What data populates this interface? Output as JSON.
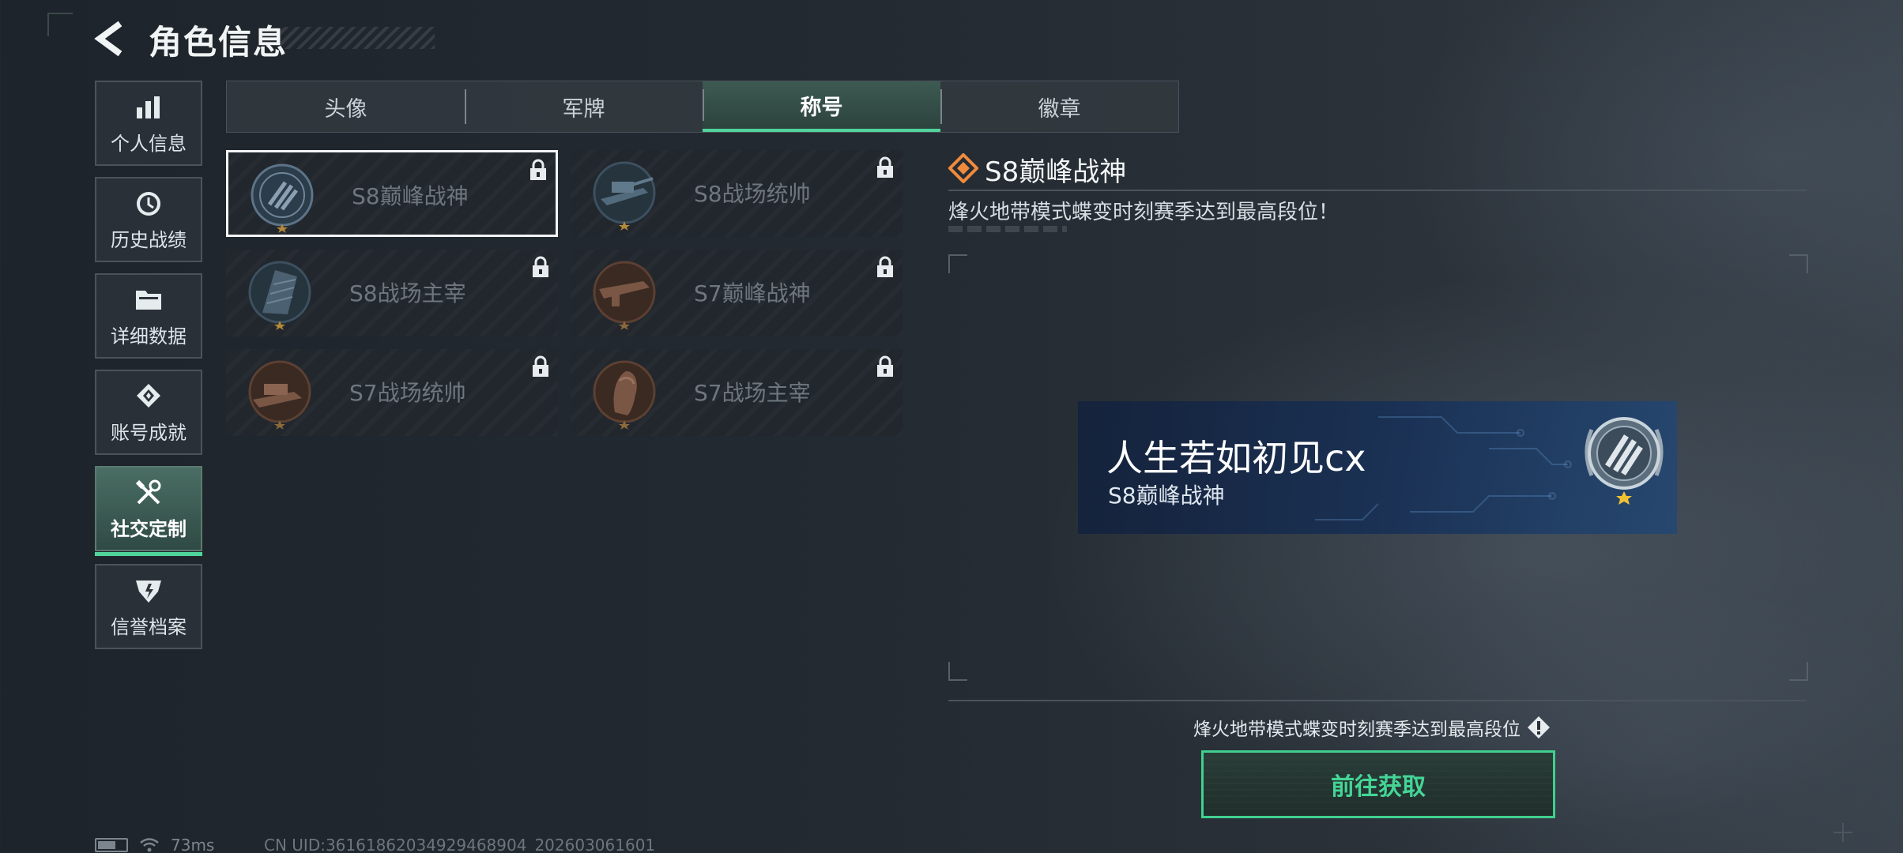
{
  "header": {
    "title": "角色信息"
  },
  "sidebar": {
    "items": [
      {
        "label": "个人信息",
        "icon": "bar-chart-icon"
      },
      {
        "label": "历史战绩",
        "icon": "clock-icon"
      },
      {
        "label": "详细数据",
        "icon": "folder-icon"
      },
      {
        "label": "账号成就",
        "icon": "achievement-icon"
      },
      {
        "label": "社交定制",
        "icon": "tools-icon",
        "active": true
      },
      {
        "label": "信誉档案",
        "icon": "shield-icon"
      }
    ]
  },
  "tabs": [
    {
      "label": "头像"
    },
    {
      "label": "军牌"
    },
    {
      "label": "称号",
      "active": true
    },
    {
      "label": "徽章"
    }
  ],
  "titles": [
    {
      "name": "S8巅峰战神",
      "locked": true,
      "selected": true
    },
    {
      "name": "S8战场统帅",
      "locked": true
    },
    {
      "name": "S8战场主宰",
      "locked": true
    },
    {
      "name": "S7巅峰战神",
      "locked": true
    },
    {
      "name": "S7战场统帅",
      "locked": true
    },
    {
      "name": "S7战场主宰",
      "locked": true
    }
  ],
  "detail": {
    "title": "S8巅峰战神",
    "description": "烽火地带模式蝶变时刻赛季达到最高段位！",
    "preview": {
      "player_name": "人生若如初见cx",
      "title": "S8巅峰战神"
    },
    "requirement": "烽火地带模式蝶变时刻赛季达到最高段位",
    "action_label": "前往获取"
  },
  "status": {
    "ping": "73ms",
    "uid": "CN UID:36161862034929468904_202603061601"
  },
  "colors": {
    "accent": "#44d597",
    "detail_icon": "#f08a3c"
  }
}
